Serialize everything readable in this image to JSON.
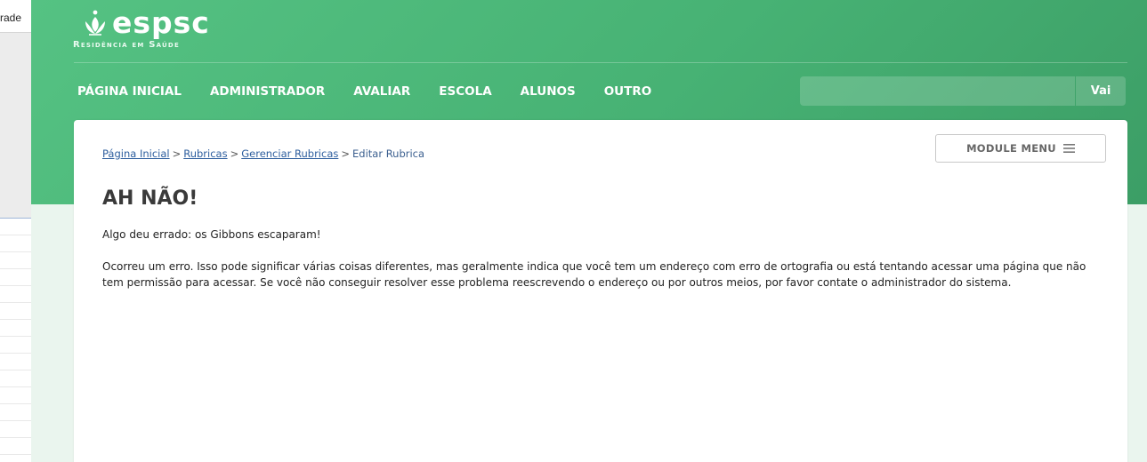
{
  "left_window": {
    "fragment_text": "rade"
  },
  "logo": {
    "name": "espsc",
    "subtitle": "Residência em Saúde"
  },
  "nav": {
    "items": [
      "PÁGINA INICIAL",
      "ADMINISTRADOR",
      "AVALIAR",
      "ESCOLA",
      "ALUNOS",
      "OUTRO"
    ]
  },
  "search": {
    "placeholder": "",
    "button_label": "Vai"
  },
  "breadcrumb": {
    "links": [
      "Página Inicial",
      "Rubricas",
      "Gerenciar Rubricas"
    ],
    "separator": ">",
    "current": "Editar Rubrica"
  },
  "module_menu": {
    "label": "MODULE MENU"
  },
  "error": {
    "title": "AH NÃO!",
    "subtitle": "Algo deu errado: os Gibbons escaparam!",
    "message": "Ocorreu um erro. Isso pode significar várias coisas diferentes, mas geralmente indica que você tem um endereço com erro de ortografia ou está tentando acessar uma página que não tem permissão para acessar. Se você não conseguir resolver esse problema reescrevendo o endereço ou por outros meios, por favor contate o administrador do sistema."
  },
  "colors": {
    "header_green": "#4cb87a",
    "link_blue": "#2d5e9e",
    "title_gray": "#3a3a3a"
  }
}
